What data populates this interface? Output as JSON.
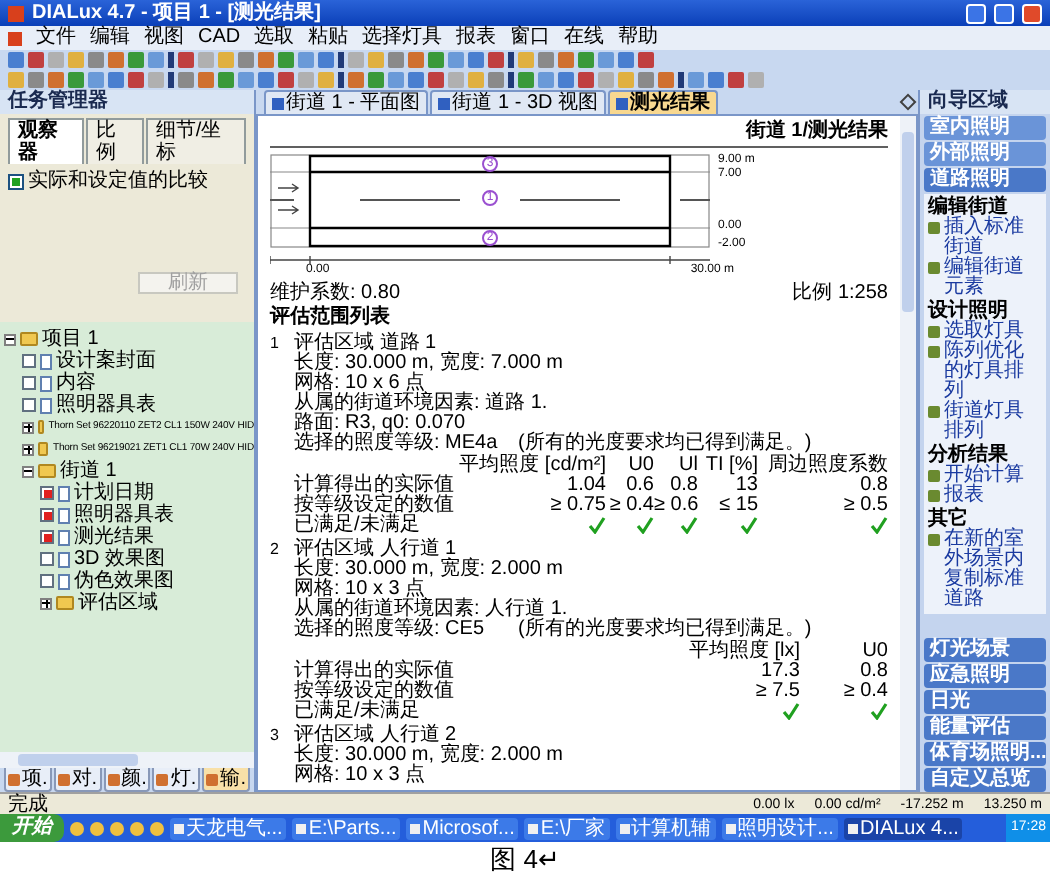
{
  "window": {
    "title": "DIALux 4.7 - 项目 1 - [测光结果]"
  },
  "menu": [
    "文件",
    "编辑",
    "视图",
    "CAD",
    "选取",
    "粘贴",
    "选择灯具",
    "报表",
    "窗口",
    "在线",
    "帮助"
  ],
  "left_panel": {
    "title": "任务管理器",
    "tabs": [
      {
        "label": "观察器",
        "selected": true
      },
      {
        "label": "比例",
        "selected": false
      },
      {
        "label": "细节/坐标",
        "selected": false
      }
    ],
    "compare_checkbox": {
      "label": "实际和设定值的比较",
      "checked": true
    },
    "refresh_button": {
      "label": "刷新",
      "disabled": true
    },
    "tree": [
      {
        "label": "项目 1",
        "kind": "folder",
        "expanded": true,
        "children": [
          {
            "label": "设计案封面",
            "kind": "page",
            "checked": false
          },
          {
            "label": "内容",
            "kind": "page",
            "checked": false
          },
          {
            "label": "照明器具表",
            "kind": "page",
            "checked": false
          },
          {
            "label": "Thorn Set 96220110 ZET2 CL1 150W 240V HID",
            "kind": "folder",
            "expanded": false
          },
          {
            "label": "Thorn Set 96219021 ZET1 CL1 70W 240V HID",
            "kind": "folder",
            "expanded": false
          },
          {
            "label": "街道 1",
            "kind": "folder",
            "expanded": true,
            "children": [
              {
                "label": "计划日期",
                "kind": "page",
                "checked": true
              },
              {
                "label": "照明器具表",
                "kind": "page",
                "checked": true
              },
              {
                "label": "测光结果",
                "kind": "page",
                "checked": true
              },
              {
                "label": "3D 效果图",
                "kind": "page",
                "checked": false
              },
              {
                "label": "伪色效果图",
                "kind": "page",
                "checked": false
              },
              {
                "label": "评估区域",
                "kind": "folder",
                "expanded": false
              }
            ]
          }
        ]
      }
    ],
    "bottom_tabs": [
      {
        "label": "项.",
        "selected": false
      },
      {
        "label": "对.",
        "selected": false
      },
      {
        "label": "颜.",
        "selected": false
      },
      {
        "label": "灯.",
        "selected": false
      },
      {
        "label": "输.",
        "selected": true
      }
    ]
  },
  "doc_tabs": [
    {
      "label": "街道 1 - 平面图",
      "selected": false
    },
    {
      "label": "街道 1 - 3D 视图",
      "selected": false
    },
    {
      "label": "测光结果",
      "selected": true
    }
  ],
  "report": {
    "title": "街道 1/测光结果",
    "drawing": {
      "y_labels": [
        "9.00 m",
        "7.00",
        "0.00",
        "-2.00"
      ],
      "x_labels": [
        "0.00",
        "30.00 m"
      ],
      "area_marks": [
        "3",
        "1",
        "2"
      ]
    },
    "maintenance": "维护系数: 0.80",
    "scale": "比例 1:258",
    "list_title": "评估范围列表",
    "areas": [
      {
        "number": "1",
        "lines": [
          "评估区域 道路 1",
          "长度: 30.000 m, 宽度: 7.000 m",
          "网格: 10 x 6 点",
          "从属的街道环境因素: 道路 1.",
          "路面: R3, q0: 0.070",
          "选择的照度等级: ME4a"
        ],
        "note": "(所有的光度要求均已得到满足。)",
        "table": {
          "columns": [
            "平均照度 [cd/m²]",
            "U0",
            "Ul",
            "TI [%]",
            "周边照度系数"
          ],
          "rows": [
            {
              "label": "计算得出的实际值",
              "cells": [
                "1.04",
                "0.6",
                "0.8",
                "13",
                "0.8"
              ]
            },
            {
              "label": "按等级设定的数值",
              "cells": [
                "≥ 0.75",
                "≥ 0.4",
                "≥ 0.6",
                "≤ 15",
                "≥ 0.5"
              ]
            }
          ],
          "met_label": "已满足/未满足",
          "met": [
            true,
            true,
            true,
            true,
            true
          ]
        }
      },
      {
        "number": "2",
        "lines": [
          "评估区域 人行道 1",
          "长度: 30.000 m, 宽度: 2.000 m",
          "网格: 10 x 3 点",
          "从属的街道环境因素: 人行道 1.",
          "选择的照度等级: CE5"
        ],
        "note": "(所有的光度要求均已得到满足。)",
        "table": {
          "columns": [
            "平均照度 [lx]",
            "U0"
          ],
          "rows": [
            {
              "label": "计算得出的实际值",
              "cells": [
                "17.3",
                "0.8"
              ]
            },
            {
              "label": "按等级设定的数值",
              "cells": [
                "≥ 7.5",
                "≥ 0.4"
              ]
            }
          ],
          "met_label": "已满足/未满足",
          "met": [
            true,
            true
          ]
        }
      },
      {
        "number": "3",
        "lines": [
          "评估区域 人行道 2",
          "长度: 30.000 m, 宽度: 2.000 m",
          "网格: 10 x 3 点"
        ]
      }
    ]
  },
  "right_panel": {
    "title": "向导区域",
    "top_buttons": [
      {
        "label": "室内照明",
        "expanded": false
      },
      {
        "label": "外部照明",
        "expanded": false
      },
      {
        "label": "道路照明",
        "expanded": true
      }
    ],
    "sections": [
      {
        "title": "编辑街道",
        "items": [
          "插入标准街道",
          "编辑街道元素"
        ]
      },
      {
        "title": "设计照明",
        "items": [
          "选取灯具",
          "陈列优化的灯具排列",
          "街道灯具排列"
        ]
      },
      {
        "title": "分析结果",
        "items": [
          "开始计算",
          "报表"
        ]
      },
      {
        "title": "其它",
        "items": [
          "在新的室外场景内复制标准道路"
        ]
      }
    ],
    "bottom_buttons": [
      "灯光场景",
      "应急照明",
      "日光",
      "能量评估",
      "体育场照明...",
      "自定义总览"
    ]
  },
  "status_bar": {
    "text": "完成",
    "readings": [
      "0.00 lx",
      "0.00 cd/m²",
      "-17.252 m",
      "13.250 m"
    ]
  },
  "taskbar": {
    "start": "开始",
    "items": [
      {
        "label": "天龙电气...",
        "selected": false
      },
      {
        "label": "E:\\Parts...",
        "selected": false
      },
      {
        "label": "Microsof...",
        "selected": false
      },
      {
        "label": "E:\\厂家",
        "selected": false
      },
      {
        "label": "计算机辅",
        "selected": false
      },
      {
        "label": "照明设计...",
        "selected": false
      },
      {
        "label": "DIALux 4...",
        "selected": true
      }
    ],
    "clock": "17:28"
  },
  "caption": "图 4↵"
}
